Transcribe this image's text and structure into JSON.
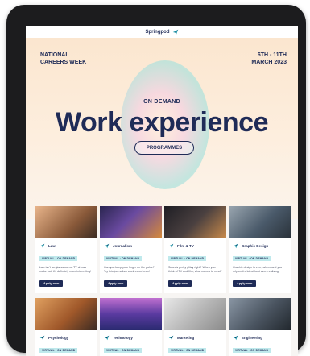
{
  "header": {
    "logo_text": "Springpod"
  },
  "hero": {
    "left_line1": "NATIONAL",
    "left_line2": "CAREERS WEEK",
    "right_line1": "6TH - 11TH",
    "right_line2": "MARCH 2023",
    "subheading": "ON DEMAND",
    "title": "Work experience",
    "button_label": "PROGRAMMES"
  },
  "cards": [
    {
      "name": "Law",
      "badge": "VIRTUAL · ON DEMAND",
      "desc": "Law isn't as glamorous as TV shows make out, it's definitely more interesting!",
      "button": "Apply now",
      "img_color": "#a36f4a"
    },
    {
      "name": "Journalism",
      "badge": "VIRTUAL · ON DEMAND",
      "desc": "Can you keep your finger on the pulse? Try this journalism work experience!",
      "button": "Apply now",
      "img_color": "#4a3a7a"
    },
    {
      "name": "Film & TV",
      "badge": "VIRTUAL · ON DEMAND",
      "desc": "Sounds pretty glitzy right? When you think of TV and film, what comes to mind?",
      "button": "Apply now",
      "img_color": "#2b2b33"
    },
    {
      "name": "Graphic Design",
      "badge": "VIRTUAL · ON DEMAND",
      "desc": "Graphic design is everywhere and you rely on it a lot without even realising!",
      "button": "Apply now",
      "img_color": "#6b7c8a"
    },
    {
      "name": "Psychology",
      "badge": "VIRTUAL · ON DEMAND",
      "desc": "",
      "button": "",
      "img_color": "#b06b2e"
    },
    {
      "name": "Technology",
      "badge": "VIRTUAL · ON DEMAND",
      "desc": "",
      "button": "",
      "img_color": "#6a4aa8"
    },
    {
      "name": "Marketing",
      "badge": "VIRTUAL · ON DEMAND",
      "desc": "",
      "button": "",
      "img_color": "#c9c9c9"
    },
    {
      "name": "Engineering",
      "badge": "VIRTUAL · ON DEMAND",
      "desc": "",
      "button": "",
      "img_color": "#5b6673"
    }
  ],
  "colors": {
    "navy": "#1f2b57",
    "accent": "#28a5b5",
    "badge": "#bfe9ec"
  }
}
